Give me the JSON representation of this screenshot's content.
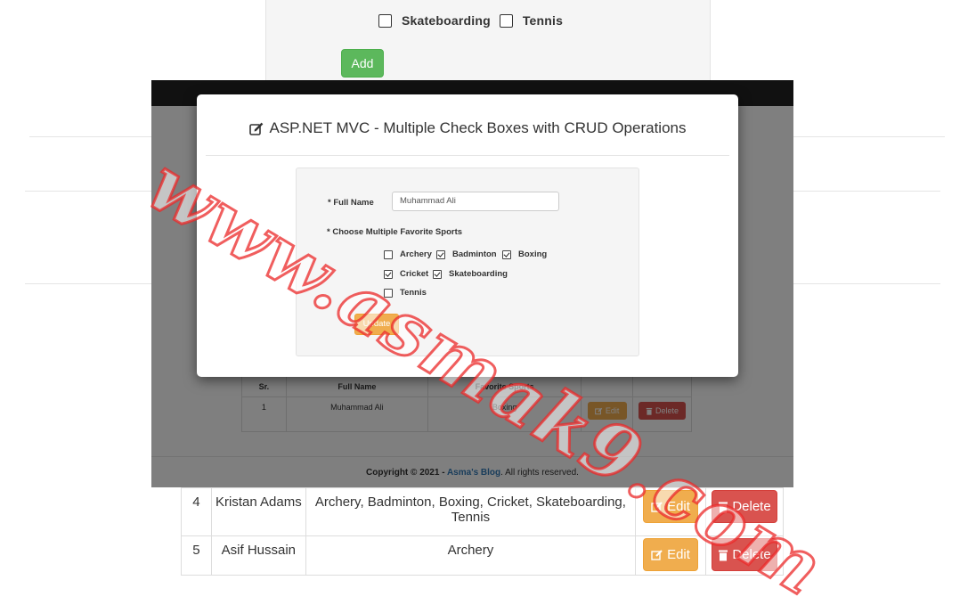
{
  "background": {
    "sports_row": [
      {
        "label": "Skateboarding",
        "checked": false
      },
      {
        "label": "Tennis",
        "checked": false
      }
    ],
    "add_label": "Add",
    "table_rows": [
      {
        "sr": "4",
        "name": "Kristan Adams",
        "sports": "Archery, Badminton, Boxing, Cricket, Skateboarding, Tennis",
        "edit": "Edit",
        "delete": "Delete"
      },
      {
        "sr": "5",
        "name": "Asif Hussain",
        "sports": "Archery",
        "edit": "Edit",
        "delete": "Delete"
      }
    ]
  },
  "inner_page": {
    "table": {
      "headers": [
        "Sr.",
        "Full Name",
        "Favorite Sports",
        "",
        ""
      ],
      "row": {
        "sr": "1",
        "name": "Muhammad Ali",
        "sports": "Boxing",
        "edit": "Edit",
        "delete": "Delete"
      }
    },
    "footer": {
      "prefix": "Copyright © 2021 - ",
      "blog": "Asma's Blog",
      "suffix": ". All rights reserved."
    }
  },
  "modal": {
    "title": "ASP.NET MVC - Multiple Check Boxes with CRUD Operations",
    "full_name_label": "* Full Name",
    "full_name_value": "Muhammad Ali",
    "sports_label": "* Choose Multiple Favorite Sports",
    "sports": [
      {
        "label": "Archery",
        "checked": false
      },
      {
        "label": "Badminton",
        "checked": true
      },
      {
        "label": "Boxing",
        "checked": true
      },
      {
        "label": "Cricket",
        "checked": true
      },
      {
        "label": "Skateboarding",
        "checked": true
      },
      {
        "label": "Tennis",
        "checked": false
      }
    ],
    "update_label": "Update"
  },
  "watermark": "www.asmak9.com",
  "colors": {
    "success": "#5cb85c",
    "warning": "#f0ad4e",
    "danger": "#d9534f",
    "navbar": "#222222",
    "link": "#337ab7"
  }
}
